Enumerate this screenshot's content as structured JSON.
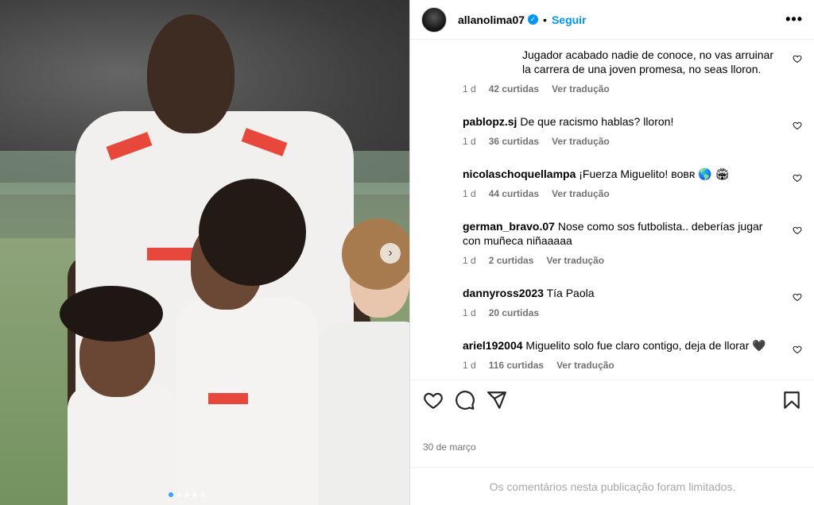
{
  "post": {
    "author": "allanolima07",
    "follow_label": "Seguir",
    "separator": "•",
    "date": "30 de março",
    "comments_limited": "Os comentários nesta publicação foram limitados."
  },
  "comments": [
    {
      "user": "",
      "text": "Jugador acabado nadie de conoce, no vas arruinar la carrera de una joven promesa, no seas lloron.",
      "time": "1 d",
      "likes": "42 curtidas",
      "translate": "Ver tradução"
    },
    {
      "user": "pablopz.sj",
      "text": "De que racismo hablas? lloron!",
      "time": "1 d",
      "likes": "36 curtidas",
      "translate": "Ver tradução"
    },
    {
      "user": "nicolaschoquellampa",
      "text": "¡Fuerza Miguelito! ʙᴏʙʀ 🌎 🏟",
      "time": "1 d",
      "likes": "44 curtidas",
      "translate": "Ver tradução"
    },
    {
      "user": "german_bravo.07",
      "text": "Nose como sos futbolista.. deberías jugar con muñeca niñaaaaa",
      "time": "1 d",
      "likes": "2 curtidas",
      "translate": "Ver tradução"
    },
    {
      "user": "dannyross2023",
      "text": "Tía Paola",
      "time": "1 d",
      "likes": "20 curtidas",
      "translate": ""
    },
    {
      "user": "ariel192004",
      "text": "Miguelito solo fue claro contigo, deja de llorar 🖤",
      "time": "1 d",
      "likes": "116 curtidas",
      "translate": "Ver tradução"
    }
  ],
  "icons": {
    "more": "more-options-icon",
    "like": "heart-icon",
    "comment": "comment-icon",
    "share": "share-icon",
    "save": "bookmark-icon",
    "next": "chevron-right-icon"
  },
  "colors": {
    "accent": "#0095f6",
    "meta": "#737373",
    "muted": "#a8a8a8"
  }
}
